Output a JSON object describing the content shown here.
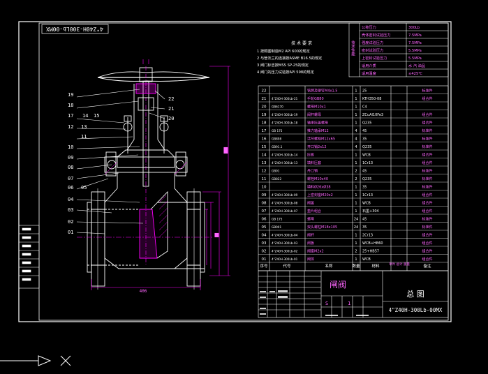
{
  "drawing": {
    "title_block": {
      "name": "闸阀",
      "drawing_title": "总 图",
      "drawing_number": "4\"Z40H-300Lb-00MX",
      "rotated_number": "4\"Z40H-300Lb-00MX",
      "sheet_vals": [
        "S",
        "1"
      ]
    },
    "tech_req": {
      "title": "技 术 要 求",
      "items": [
        "1  按照图制造M2 API 600的规定",
        "2  与管法兰的连接按ASME B16.5的规定",
        "3  阀门标志按MSS SP-25的规定",
        "4  阀门的压力试验按API 598的规定"
      ]
    },
    "perf_table": {
      "side_label": "技术性能",
      "rows": [
        {
          "label": "公称压力",
          "value": "300Lb"
        },
        {
          "label": "壳体密封试验压力",
          "value": "7.5MPa"
        },
        {
          "label": "强度试验压力",
          "value": "7.5MPa"
        },
        {
          "label": "密封试验压力",
          "value": "5.5MPa"
        },
        {
          "label": "上密封试验压力",
          "value": "5.5MPa"
        },
        {
          "label": "适用介质",
          "value": "水 汽 油品"
        },
        {
          "label": "适用温度",
          "value": "≤425℃"
        }
      ]
    },
    "bom": {
      "header": [
        "序号",
        "代号",
        "名称",
        "数量",
        "材料",
        "单件 总计 重量",
        "备注"
      ],
      "rows": [
        {
          "no": "22",
          "code": "",
          "name": "铭牌及铆钉M4x1.5",
          "qty": "1",
          "mat": "25",
          "note": "标准件"
        },
        {
          "no": "21",
          "code": "4\"Z40H-300Lb-21",
          "name": "手轮GB80",
          "qty": "1",
          "mat": "KTH350-08",
          "note": "组合件"
        },
        {
          "no": "20",
          "code": "GB6170",
          "name": "螺母M10x1",
          "qty": "1",
          "mat": "C4",
          "note": ""
        },
        {
          "no": "19",
          "code": "4\"Z40H-300Lb-19",
          "name": "阀杆螺母",
          "qty": "1",
          "mat": "ZCuAl10Fe3",
          "note": "组合件"
        },
        {
          "no": "18",
          "code": "4\"Z40H-300Lb-18",
          "name": "轴承压盖螺母",
          "qty": "1",
          "mat": "Q235",
          "note": "组合件"
        },
        {
          "no": "17",
          "code": "GB 175",
          "name": "推力轴承M12",
          "qty": "4",
          "mat": "45",
          "note": "标准件"
        },
        {
          "no": "16",
          "code": "GB898",
          "name": "活节螺栓M12x65",
          "qty": "4",
          "mat": "35",
          "note": "标准件"
        },
        {
          "no": "15",
          "code": "GB91.1",
          "name": "开口销2x12",
          "qty": "4",
          "mat": "Q235",
          "note": "标准件"
        },
        {
          "no": "14",
          "code": "4\"Z40H-300Lb-14",
          "name": "压板",
          "qty": "1",
          "mat": "WCB",
          "note": "组合件"
        },
        {
          "no": "13",
          "code": "4\"Z40H-300Lb-13",
          "name": "填料压套",
          "qty": "1",
          "mat": "1Cr13",
          "note": "组合件"
        },
        {
          "no": "12",
          "code": "GB91",
          "name": "丹口销",
          "qty": "2",
          "mat": "45",
          "note": "标准件"
        },
        {
          "no": "11",
          "code": "GB822",
          "name": "螺栓M10x40",
          "qty": "2",
          "mat": "Q235",
          "note": "标准件"
        },
        {
          "no": "10",
          "code": "",
          "name": "填料Ø26xØ38",
          "qty": "1",
          "mat": "35",
          "note": "标准件"
        },
        {
          "no": "09",
          "code": "4\"Z40H-300Lb-09",
          "name": "上密封座M20x2",
          "qty": "1",
          "mat": "1Cr13",
          "note": "组合件"
        },
        {
          "no": "08",
          "code": "4\"Z40H-300Lb-08",
          "name": "阀盖",
          "qty": "1",
          "mat": "WCB",
          "note": "组合件"
        },
        {
          "no": "07",
          "code": "4\"Z40H-300Lb-07",
          "name": "垫片组合",
          "qty": "1",
          "mat": "石墨+304",
          "note": "组合件"
        },
        {
          "no": "06",
          "code": "GB 175",
          "name": "螺母",
          "qty": "24",
          "mat": "45",
          "note": "标准件"
        },
        {
          "no": "05",
          "code": "GB901",
          "name": "双头螺柱M18x105",
          "qty": "24",
          "mat": "35",
          "note": "标准件"
        },
        {
          "no": "04",
          "code": "4\"Z40H-300Lb-04",
          "name": "阀杆",
          "qty": "1",
          "mat": "2Cr13",
          "note": "组合件"
        },
        {
          "no": "03",
          "code": "4\"Z40H-300Lb-03",
          "name": "闸板",
          "qty": "1",
          "mat": "WCB+HB60",
          "note": "组合件"
        },
        {
          "no": "02",
          "code": "4\"Z40H-300Lb-02",
          "name": "阀座M2x2",
          "qty": "2",
          "mat": "25+HB57",
          "note": "组合件"
        },
        {
          "no": "01",
          "code": "4\"Z40H-300Lb-01",
          "name": "阀体",
          "qty": "1",
          "mat": "WCB",
          "note": "组合件"
        }
      ]
    },
    "balloons_left": [
      "19",
      "18",
      "17",
      "14",
      "15",
      "13",
      "12",
      "11",
      "10",
      "09",
      "08",
      "07",
      "06",
      "05",
      "04",
      "03",
      "02",
      "01"
    ],
    "balloons_right": [
      "22",
      "21",
      "20"
    ],
    "dims": {
      "bottom": "406"
    },
    "colors": {
      "bg": "#000000",
      "line": "#ffffff",
      "accent": "#ff00ff",
      "text_mag": "#ff66ff"
    }
  }
}
